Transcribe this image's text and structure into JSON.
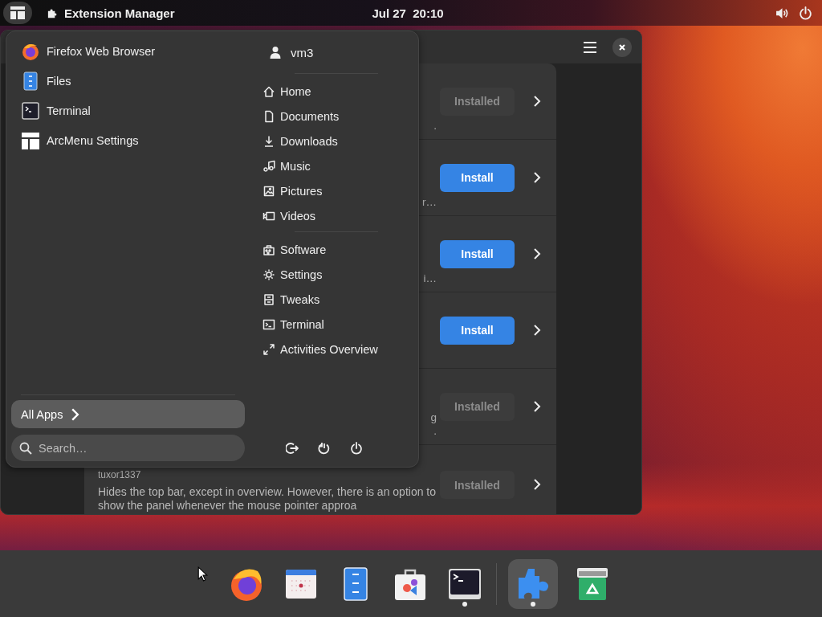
{
  "top_bar": {
    "app_name": "Extension Manager",
    "clock": "Jul 27  20:10"
  },
  "window": {
    "rows": [
      {
        "fragment_lines": [
          "."
        ],
        "button": "Installed",
        "installed": true
      },
      {
        "fragment_lines": [
          "r…"
        ],
        "button": "Install",
        "installed": false
      },
      {
        "fragment_lines": [
          "i…"
        ],
        "button": "Install",
        "installed": false
      },
      {
        "fragment_lines": [],
        "button": "Install",
        "installed": false
      },
      {
        "fragment_lines": [
          "g",
          "."
        ],
        "button": "Installed",
        "installed": true
      },
      {
        "author": "tuxor1337",
        "description": "Hides the top bar, except in overview. However, there is an option to show the panel whenever the mouse pointer approa",
        "button": "Installed",
        "installed": true
      }
    ]
  },
  "menu": {
    "apps": [
      {
        "label": "Firefox Web Browser"
      },
      {
        "label": "Files"
      },
      {
        "label": "Terminal"
      },
      {
        "label": "ArcMenu Settings"
      }
    ],
    "user": "vm3",
    "places": [
      {
        "label": "Home"
      },
      {
        "label": "Documents"
      },
      {
        "label": "Downloads"
      },
      {
        "label": "Music"
      },
      {
        "label": "Pictures"
      },
      {
        "label": "Videos"
      }
    ],
    "system": [
      {
        "label": "Software"
      },
      {
        "label": "Settings"
      },
      {
        "label": "Tweaks"
      },
      {
        "label": "Terminal"
      },
      {
        "label": "Activities Overview"
      }
    ],
    "all_apps": "All Apps",
    "search": {
      "placeholder": "Search…"
    }
  },
  "dock": {
    "items": [
      {
        "running": false,
        "focused": false
      },
      {
        "running": false,
        "focused": false
      },
      {
        "running": false,
        "focused": false
      },
      {
        "running": false,
        "focused": false
      },
      {
        "running": true,
        "focused": false
      },
      {
        "running": true,
        "focused": true
      },
      {
        "running": false,
        "focused": false
      }
    ]
  }
}
